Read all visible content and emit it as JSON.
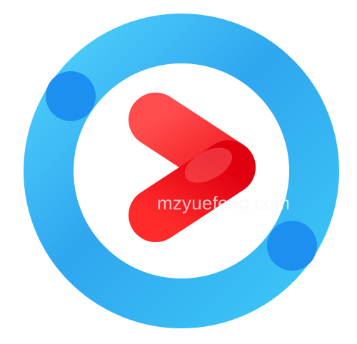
{
  "logo": {
    "icon": "play-ring-logo",
    "ring_color_light": "#3ec3f7",
    "ring_color_dark": "#1f8fea",
    "dot_color": "#1a8ff0",
    "play_color_top": "#ff4a4a",
    "play_color_bottom": "#e40010"
  },
  "watermark": {
    "text": "mzyuefeng.com"
  }
}
